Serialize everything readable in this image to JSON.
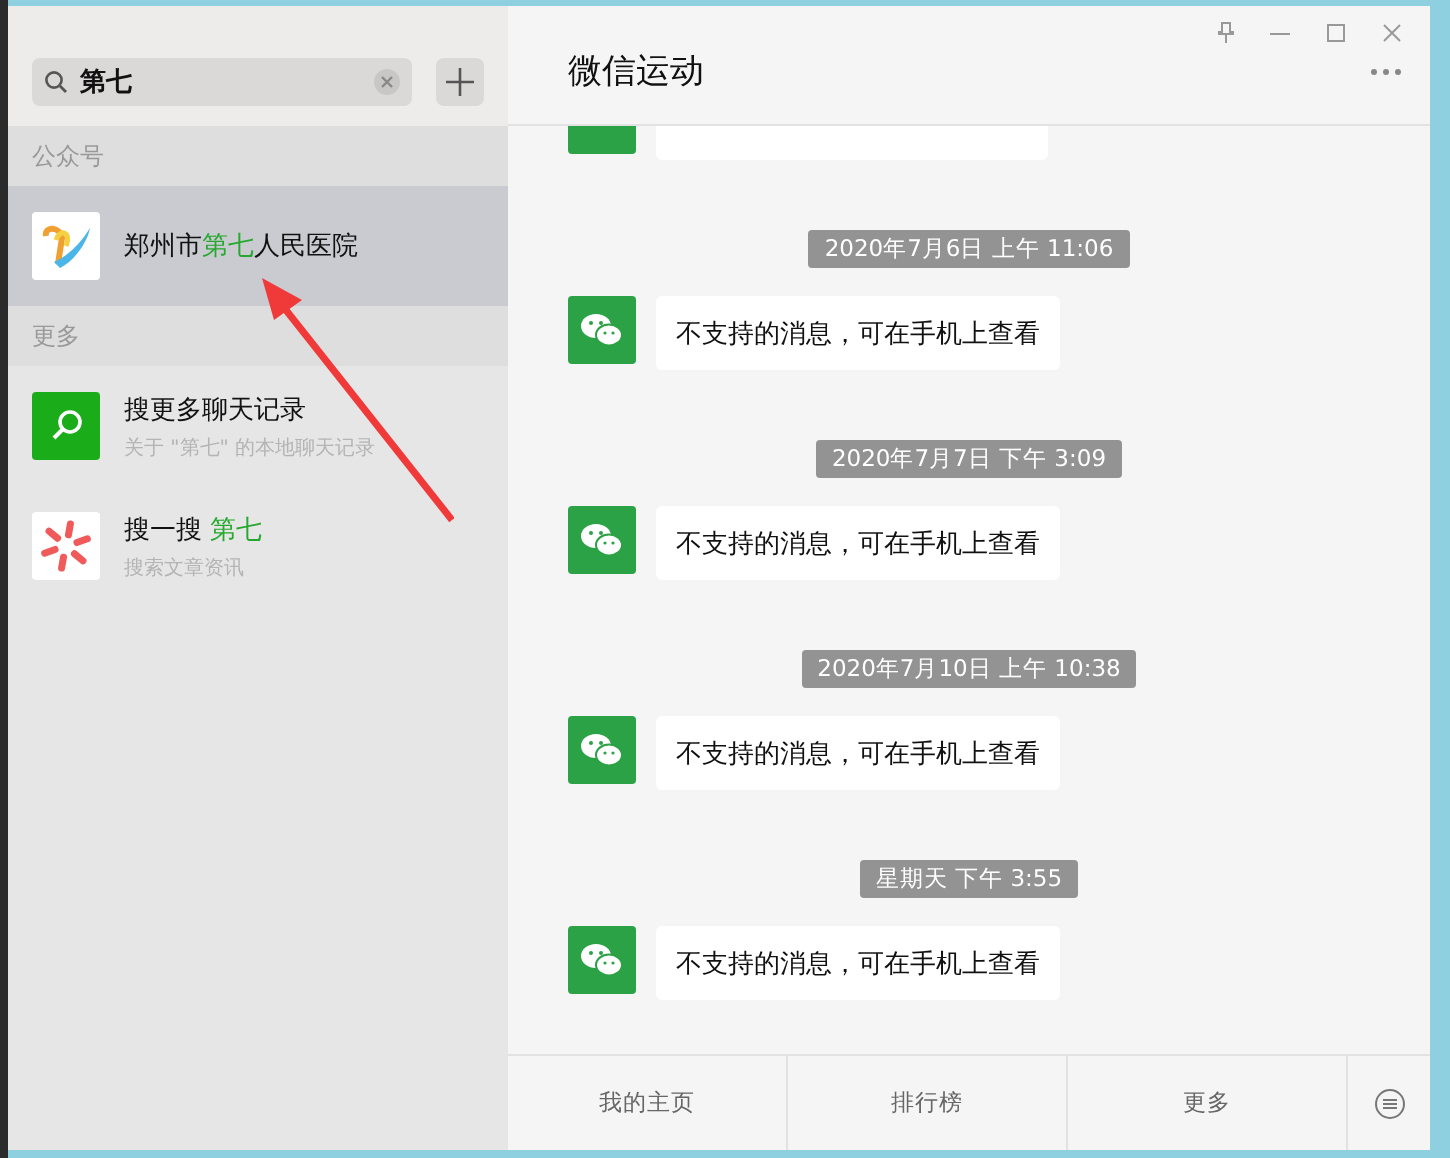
{
  "sidebar": {
    "search": {
      "value": "第七"
    },
    "sections": [
      {
        "header": "公众号",
        "items": [
          {
            "kind": "account",
            "selected": true,
            "title_parts": [
              {
                "text": "郑州市",
                "highlight": false
              },
              {
                "text": "第七",
                "highlight": true
              },
              {
                "text": "人民医院",
                "highlight": false
              }
            ]
          }
        ]
      },
      {
        "header": "更多",
        "items": [
          {
            "kind": "chat-search",
            "selected": false,
            "title_parts": [
              {
                "text": "搜更多聊天记录",
                "highlight": false
              }
            ],
            "subtitle": "关于 \"第七\" 的本地聊天记录"
          },
          {
            "kind": "web-search",
            "selected": false,
            "title_parts": [
              {
                "text": "搜一搜 ",
                "highlight": false
              },
              {
                "text": "第七",
                "highlight": true
              }
            ],
            "subtitle": "搜索文章资讯"
          }
        ]
      }
    ]
  },
  "chat": {
    "title": "微信运动",
    "cut_message_above": true,
    "messages": [
      {
        "time": "2020年7月6日 上午 11:06",
        "text": "不支持的消息，可在手机上查看"
      },
      {
        "time": "2020年7月7日 下午 3:09",
        "text": "不支持的消息，可在手机上查看"
      },
      {
        "time": "2020年7月10日 上午 10:38",
        "text": "不支持的消息，可在手机上查看"
      },
      {
        "time": "星期天 下午 3:55",
        "text": "不支持的消息，可在手机上查看"
      }
    ],
    "bottom_tabs": [
      "我的主页",
      "排行榜",
      "更多"
    ]
  }
}
